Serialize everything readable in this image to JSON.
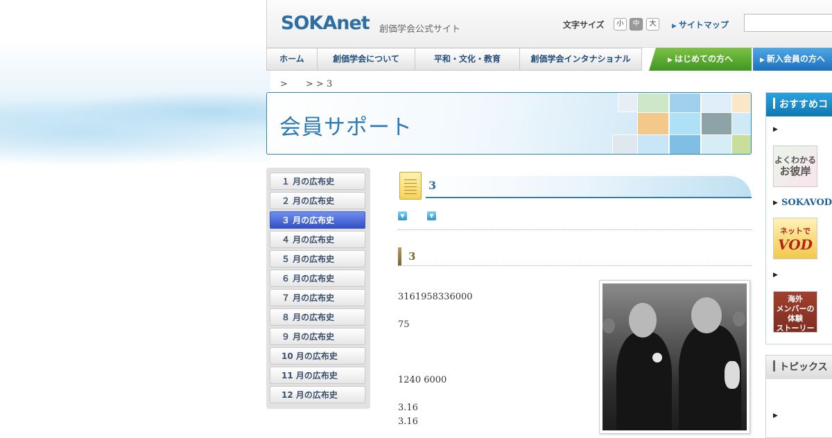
{
  "header": {
    "logo": "SOKAnet",
    "logo_sub": "創価学会公式サイト",
    "font_size_label": "文字サイズ",
    "font_sizes": [
      "小",
      "中",
      "大"
    ],
    "sitemap": "サイトマップ"
  },
  "global_nav": [
    "ホーム",
    "創価学会について",
    "平和・文化・教育",
    "創価学会インタナショナル"
  ],
  "tabs": {
    "first_time": "はじめての方へ",
    "new_member": "新入会員の方へ"
  },
  "breadcrumb": ">　　> > 3",
  "banner": {
    "title": "会員サポート"
  },
  "side_menu": {
    "items": [
      "１ 月の広布史",
      "２ 月の広布史",
      "３ 月の広布史",
      "４ 月の広布史",
      "５ 月の広布史",
      "６ 月の広布史",
      "７ 月の広布史",
      "８ 月の広布史",
      "９ 月の広布史",
      "10 月の広布史",
      "11 月の広布史",
      "12 月の広布史"
    ],
    "active_index": 2
  },
  "content": {
    "title": "3",
    "section_title": "3",
    "paragraphs": [
      "3161958336000",
      "75",
      "1240 6000",
      "3.16",
      "3.16"
    ]
  },
  "right": {
    "recommend_title": "おすすめコ",
    "link_sokavod": "SOKAVOD",
    "thumb_higan": [
      "よくわかる",
      "お彼岸"
    ],
    "thumb_vod": [
      "ネットで",
      "VOD"
    ],
    "thumb_story": [
      "海外",
      "メンバーの",
      "体験",
      "ストーリー"
    ],
    "topics_title": "トピックス"
  },
  "colors": {
    "brand_blue": "#2d6fa3",
    "nav_green": "#3f9624",
    "nav_blue": "#1d6fbd",
    "active_menu": "#3450c4"
  }
}
